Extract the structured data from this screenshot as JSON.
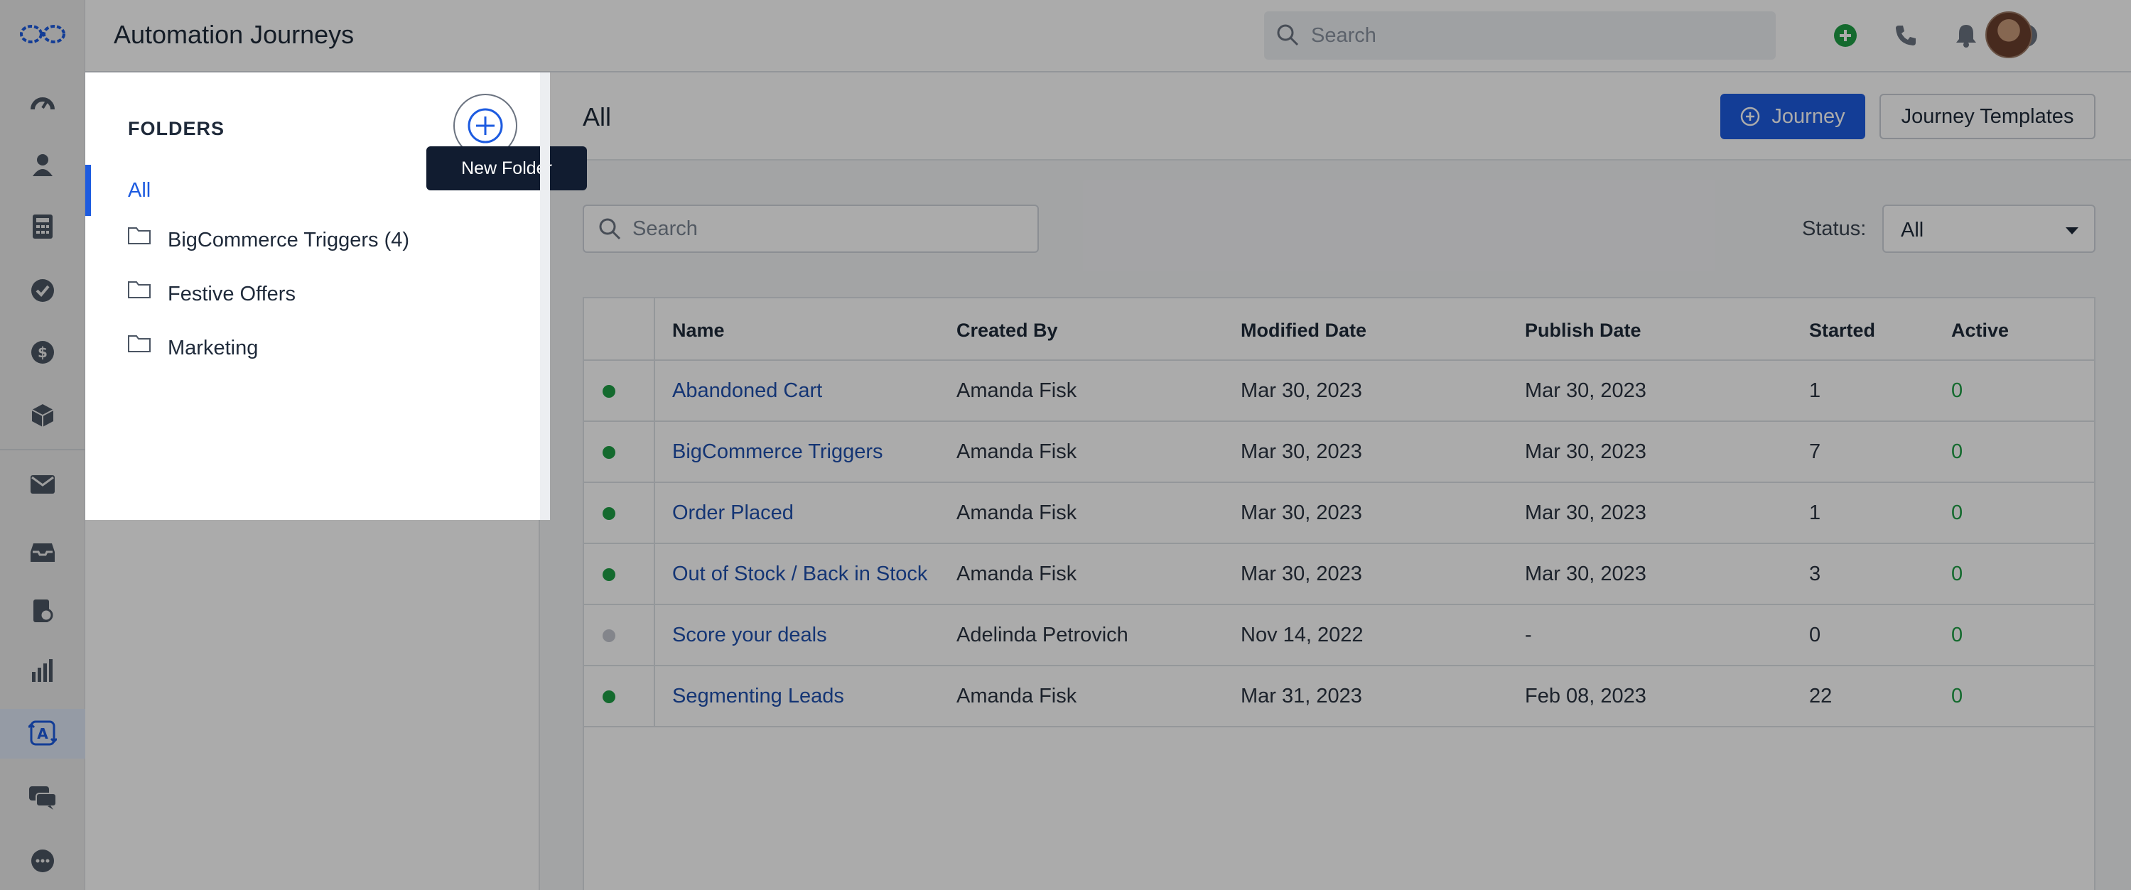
{
  "app": {
    "title": "Automation Journeys"
  },
  "topbar": {
    "search_placeholder": "Search",
    "icons": [
      "add-circle-icon",
      "phone-icon",
      "bell-icon",
      "help-icon",
      "avatar"
    ],
    "add_color": "#1e9e45"
  },
  "rail": {
    "items": [
      "dashboard-icon",
      "contacts-icon",
      "calculator-icon",
      "check-circle-icon",
      "dollar-icon",
      "box-icon",
      "mail-icon",
      "inbox-icon",
      "report-icon",
      "bar-chart-icon",
      "automation-icon",
      "chat-icon",
      "more-icon"
    ],
    "active": "automation-icon"
  },
  "folders": {
    "heading": "FOLDERS",
    "new_folder_tooltip": "New Folder",
    "all_label": "All",
    "items": [
      {
        "label": "BigCommerce Triggers (4)"
      },
      {
        "label": "Festive Offers"
      },
      {
        "label": "Marketing"
      }
    ]
  },
  "content": {
    "title": "All",
    "journey_button": "Journey",
    "templates_button": "Journey Templates",
    "search_placeholder": "Search",
    "status_label": "Status:",
    "status_value": "All"
  },
  "table": {
    "columns": [
      "Name",
      "Created By",
      "Modified Date",
      "Publish Date",
      "Started",
      "Active"
    ],
    "rows": [
      {
        "status": "active",
        "name": "Abandoned Cart",
        "created_by": "Amanda Fisk",
        "modified": "Mar 30, 2023",
        "published": "Mar 30, 2023",
        "started": "1",
        "active": "0"
      },
      {
        "status": "active",
        "name": "BigCommerce Triggers",
        "created_by": "Amanda Fisk",
        "modified": "Mar 30, 2023",
        "published": "Mar 30, 2023",
        "started": "7",
        "active": "0"
      },
      {
        "status": "active",
        "name": "Order Placed",
        "created_by": "Amanda Fisk",
        "modified": "Mar 30, 2023",
        "published": "Mar 30, 2023",
        "started": "1",
        "active": "0"
      },
      {
        "status": "active",
        "name": "Out of Stock / Back in Stock",
        "created_by": "Amanda Fisk",
        "modified": "Mar 30, 2023",
        "published": "Mar 30, 2023",
        "started": "3",
        "active": "0"
      },
      {
        "status": "inactive",
        "name": "Score your deals",
        "created_by": "Adelinda Petrovich",
        "modified": "Nov 14, 2022",
        "published": "-",
        "started": "0",
        "active": "0"
      },
      {
        "status": "active",
        "name": "Segmenting Leads",
        "created_by": "Amanda Fisk",
        "modified": "Mar 31, 2023",
        "published": "Feb 08, 2023",
        "started": "22",
        "active": "0"
      }
    ],
    "status_colors": {
      "active": "#1e9e45",
      "inactive": "#c3c7cf"
    }
  },
  "colors": {
    "accent": "#1d5be0",
    "link": "#1f4fae",
    "tooltip_bg": "#111c30"
  }
}
